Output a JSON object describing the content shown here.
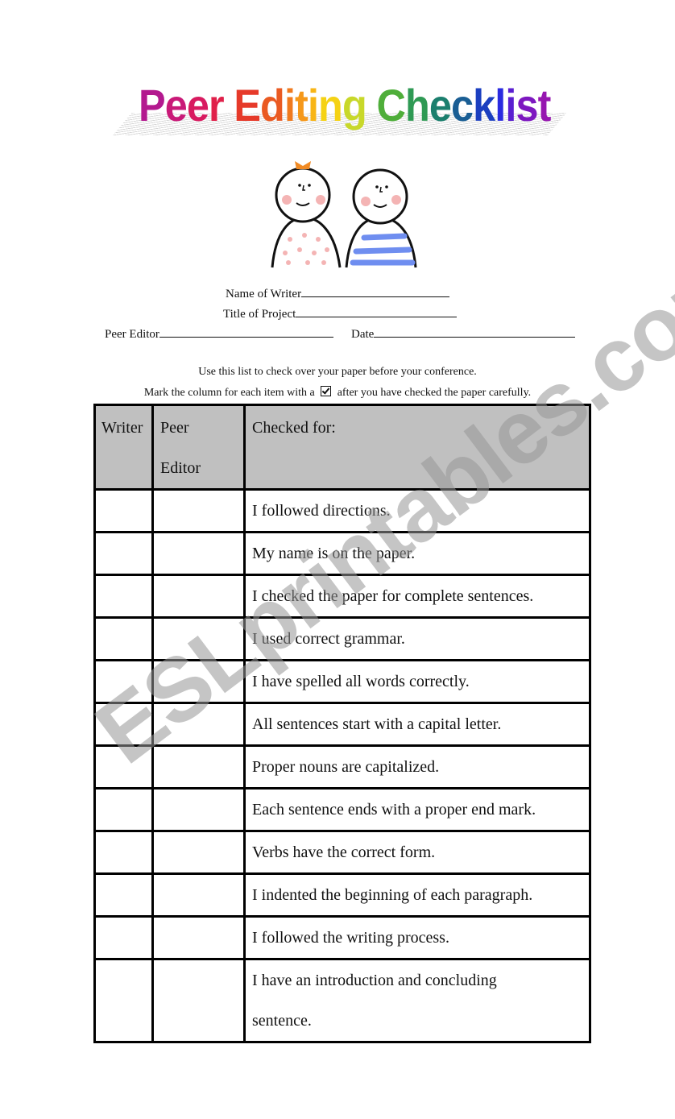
{
  "title": {
    "text": "Peer Editing Checklist",
    "letters": [
      {
        "ch": "P",
        "color": "#b3198f"
      },
      {
        "ch": "e",
        "color": "#c91a78"
      },
      {
        "ch": "e",
        "color": "#d81b60"
      },
      {
        "ch": "r",
        "color": "#e0204a"
      },
      {
        "ch": " ",
        "color": "#000000"
      },
      {
        "ch": "E",
        "color": "#e63a2a"
      },
      {
        "ch": "d",
        "color": "#ea5a22"
      },
      {
        "ch": "i",
        "color": "#f07a1e"
      },
      {
        "ch": "t",
        "color": "#f5981a"
      },
      {
        "ch": "i",
        "color": "#f8b516"
      },
      {
        "ch": "n",
        "color": "#f5d214"
      },
      {
        "ch": "g",
        "color": "#c8d82a"
      },
      {
        "ch": " ",
        "color": "#000000"
      },
      {
        "ch": "C",
        "color": "#4fae3a"
      },
      {
        "ch": "h",
        "color": "#2f9a54"
      },
      {
        "ch": "e",
        "color": "#1b7f6e"
      },
      {
        "ch": "c",
        "color": "#1a5e94"
      },
      {
        "ch": "k",
        "color": "#1b3fc0"
      },
      {
        "ch": "l",
        "color": "#2a2be0"
      },
      {
        "ch": "i",
        "color": "#5a1fd0"
      },
      {
        "ch": "s",
        "color": "#7d18c0"
      },
      {
        "ch": "t",
        "color": "#9616b0"
      }
    ]
  },
  "illustration": {
    "description": "two smiling cartoon children",
    "colors": {
      "bow": "#f08a24",
      "cheeks": "#f4b4b4",
      "stripes": "#6f8ef0",
      "outline": "#111111"
    }
  },
  "form": {
    "name_of_writer_label": "Name of Writer",
    "title_of_project_label": "Title of Project",
    "peer_editor_label": "Peer Editor",
    "date_label": "Date"
  },
  "instructions": {
    "line1": "Use this list to check over your paper before your conference.",
    "line2_before": "Mark the column for each item with a",
    "line2_after": "after you have checked the paper carefully."
  },
  "table": {
    "headers": {
      "writer": "Writer",
      "peer_editor_line1": "Peer",
      "peer_editor_line2": "Editor",
      "checked_for": "Checked for:"
    },
    "header_bg": "#c0c0c0",
    "items": [
      "I followed directions.",
      "My name is on the paper.",
      "I checked the paper for complete sentences.",
      "I used correct grammar.",
      "I have spelled all words correctly.",
      "All sentences start with a capital letter.",
      "Proper nouns are capitalized.",
      "Each sentence ends with a proper end mark.",
      "Verbs have the correct form.",
      "I indented the beginning of each paragraph.",
      "I followed the writing process."
    ],
    "last_item_line1": "I have an introduction and concluding",
    "last_item_line2": "sentence."
  },
  "watermark": "ESLprintables.com"
}
